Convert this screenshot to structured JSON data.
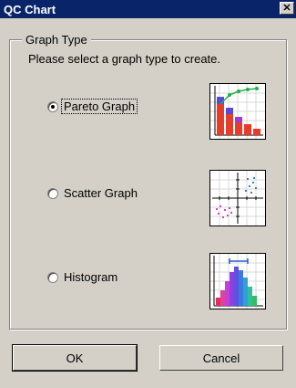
{
  "window": {
    "title": "QC Chart",
    "close_glyph": "✕"
  },
  "group": {
    "legend": "Graph Type",
    "prompt": "Please select a graph type to create."
  },
  "options": [
    {
      "label": "Pareto Graph",
      "checked": true,
      "icon": "pareto-chart-icon"
    },
    {
      "label": "Scatter Graph",
      "checked": false,
      "icon": "scatter-chart-icon"
    },
    {
      "label": "Histogram",
      "checked": false,
      "icon": "histogram-chart-icon"
    }
  ],
  "buttons": {
    "ok": "OK",
    "cancel": "Cancel"
  },
  "colors": {
    "titlebar": "#0a246a",
    "face": "#d4d0c8"
  }
}
